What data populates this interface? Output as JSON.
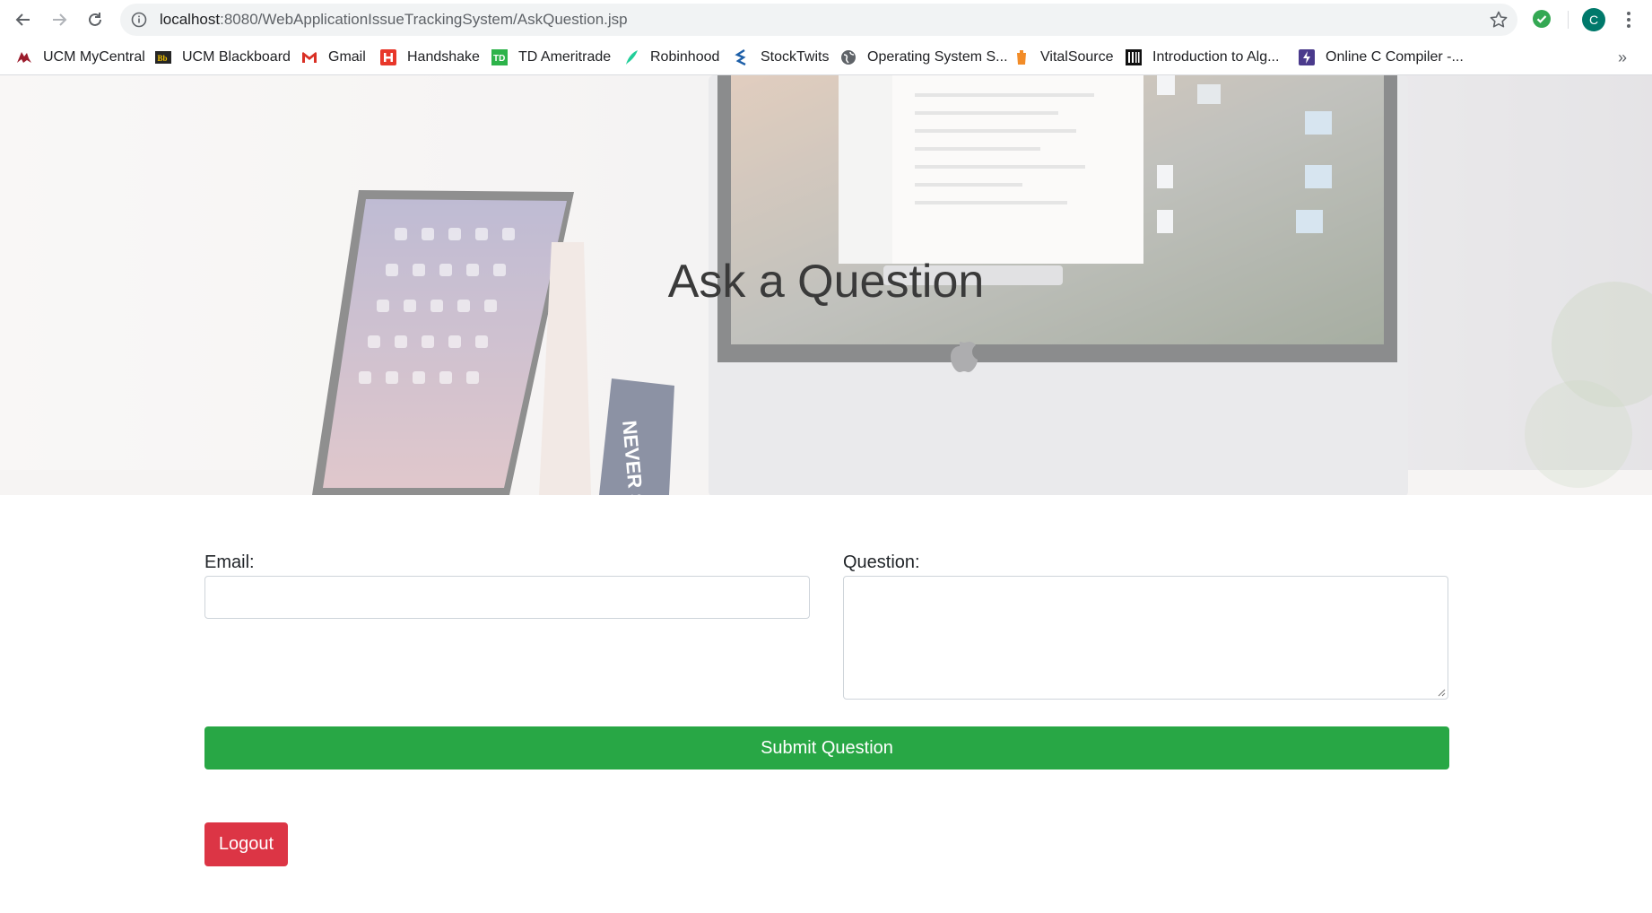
{
  "browser": {
    "url_host": "localhost",
    "url_rest": ":8080/WebApplicationIssueTrackingSystem/AskQuestion.jsp",
    "avatar_letter": "C",
    "bookmarks": [
      {
        "label": "UCM MyCentral",
        "icon": "ucm-bobcat-icon"
      },
      {
        "label": "UCM Blackboard",
        "icon": "blackboard-icon"
      },
      {
        "label": "Gmail",
        "icon": "gmail-icon"
      },
      {
        "label": "Handshake",
        "icon": "handshake-icon"
      },
      {
        "label": "TD Ameritrade",
        "icon": "td-ameritrade-icon"
      },
      {
        "label": "Robinhood",
        "icon": "robinhood-feather-icon"
      },
      {
        "label": "StockTwits",
        "icon": "stocktwits-icon"
      },
      {
        "label": "Operating System S...",
        "icon": "globe-icon"
      },
      {
        "label": "VitalSource",
        "icon": "vitalsource-icon"
      },
      {
        "label": "Introduction to Alg...",
        "icon": "algorithms-icon"
      },
      {
        "label": "Online C Compiler -...",
        "icon": "compiler-bolt-icon"
      }
    ],
    "more_label": "»"
  },
  "hero": {
    "title": "Ask a Question",
    "sign_text": "NEVER SETTLE"
  },
  "form": {
    "email_label": "Email:",
    "email_value": "",
    "question_label": "Question:",
    "question_value": "",
    "submit_label": "Submit Question",
    "logout_label": "Logout"
  },
  "colors": {
    "submit": "#28a745",
    "logout": "#dc3545",
    "avatar": "#00796b"
  }
}
